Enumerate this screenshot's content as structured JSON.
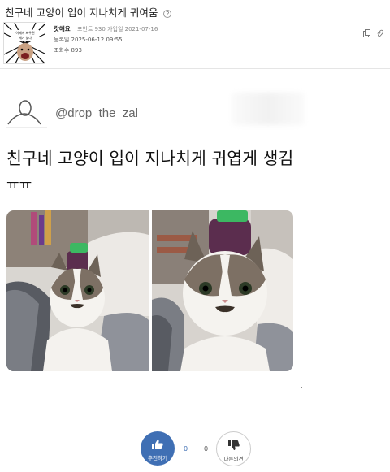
{
  "post": {
    "title": "친구네 고양이 입이 지나치게 귀여움",
    "comment_count": "2"
  },
  "author": {
    "nickname": "캇해요",
    "points_line": "포인트 930 가입일 2021-07-16",
    "date_line": "등록일 2025-06-12 09:55",
    "views_line": "조회수 893",
    "thumb_caption_top": "이제게 싸우면",
    "thumb_caption_bottom": "세기 싫다"
  },
  "toolbar": {
    "copy_icon": "copy-icon",
    "attachment_icon": "paperclip-icon"
  },
  "tweet": {
    "handle": "@drop_the_zal",
    "text": "친구네 고양이 입이 지나치게 귀엽게 생김",
    "text2": "ㅠㅠ",
    "photos": [
      "cat-photo-1",
      "cat-photo-2"
    ]
  },
  "vote": {
    "up_label": "추천하기",
    "up_count": "0",
    "down_count": "0",
    "down_label": "다른의견"
  },
  "colors": {
    "accent": "#3f6fb4",
    "divider": "#e5e5e5"
  }
}
